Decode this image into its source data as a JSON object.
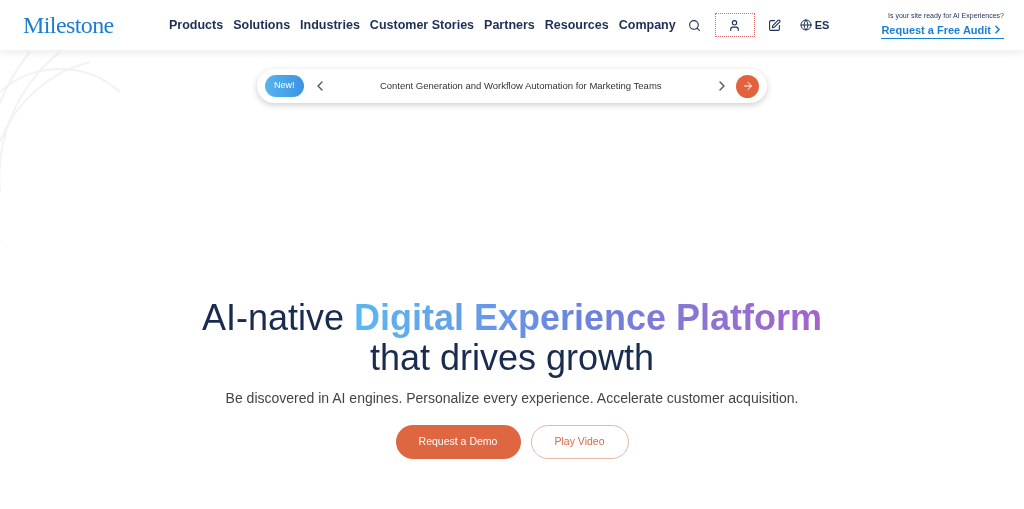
{
  "header": {
    "logo": "Milestone",
    "nav": [
      "Products",
      "Solutions",
      "Industries",
      "Customer Stories",
      "Partners",
      "Resources",
      "Company"
    ],
    "tools": [
      {
        "kind": "search",
        "focused": false
      },
      {
        "kind": "account",
        "focused": true
      },
      {
        "kind": "edit",
        "focused": false
      }
    ],
    "language": "ES",
    "audit": {
      "prompt": "Is your site ready for AI Experiences?",
      "link": "Request a Free Audit"
    }
  },
  "announcement": {
    "badge": "New!",
    "text": "Content Generation and Workflow Automation for Marketing Teams"
  },
  "hero": {
    "headline_lead": "AI-native",
    "headline_highlight": "Digital Experience Platform",
    "headline_line2": "that drives growth",
    "subtitle": "Be discovered in AI engines. Personalize every experience. Accelerate customer acquisition.",
    "buttons": [
      {
        "kind": "primary",
        "label": "Request a Demo"
      },
      {
        "kind": "outline",
        "label": "Play Video"
      }
    ]
  }
}
